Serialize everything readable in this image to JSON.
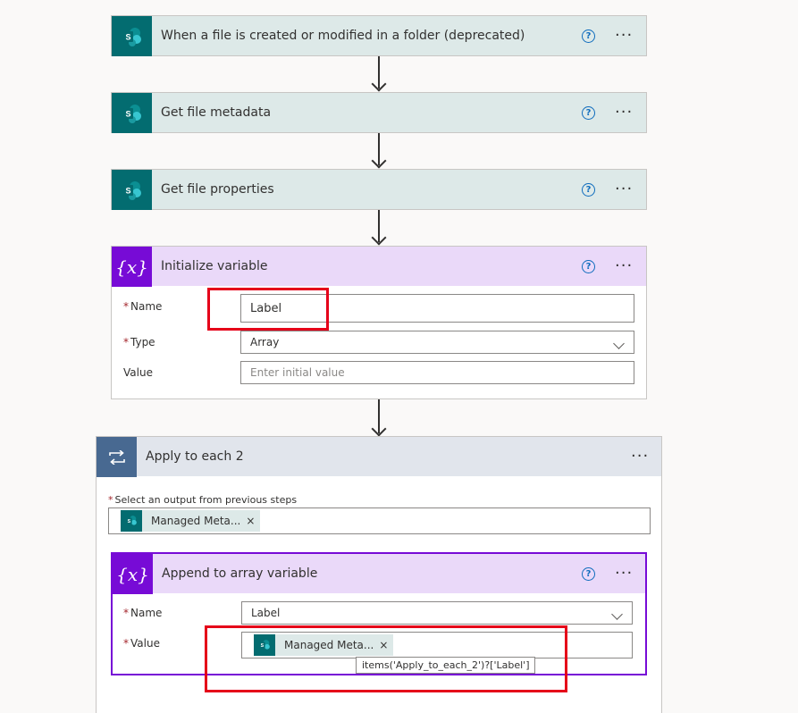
{
  "steps": {
    "trigger": {
      "title": "When a file is created or modified in a folder (deprecated)"
    },
    "get_metadata": {
      "title": "Get file metadata"
    },
    "get_properties": {
      "title": "Get file properties"
    },
    "init_variable": {
      "title": "Initialize variable",
      "name_label": "Name",
      "name_value": "Label",
      "type_label": "Type",
      "type_value": "Array",
      "value_label": "Value",
      "value_placeholder": "Enter initial value"
    },
    "apply_each": {
      "title": "Apply to each 2",
      "select_label": "Select an output from previous steps",
      "token_label": "Managed Meta...",
      "token_close": "×"
    },
    "append": {
      "title": "Append to array variable",
      "name_label": "Name",
      "name_value": "Label",
      "value_label": "Value",
      "token_label": "Managed Meta...",
      "token_close": "×",
      "tooltip": "items('Apply_to_each_2')?['Label']"
    }
  },
  "common": {
    "required_mark": "*",
    "help_glyph": "?",
    "more_glyph": "···"
  },
  "colors": {
    "sharepoint": "#036c70",
    "variable": "#770bd6",
    "highlight": "#e50019",
    "loop": "#486991"
  },
  "icons": {
    "sharepoint": "sharepoint-icon",
    "variable": "variable-icon",
    "loop": "loop-icon",
    "help": "help-icon",
    "more": "more-icon"
  }
}
